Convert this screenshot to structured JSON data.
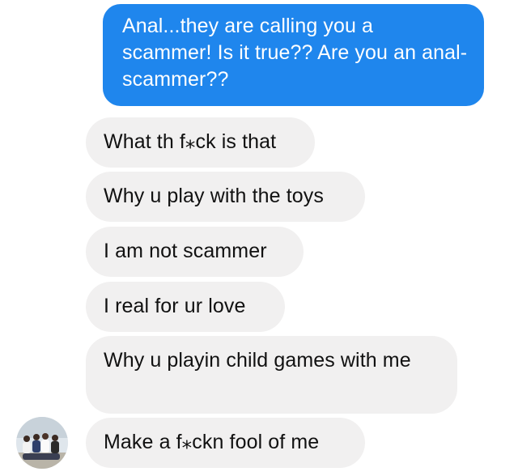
{
  "conversation": {
    "sent": [
      {
        "text": "Anal...they are calling you a scammer! Is it true?? Are you an anal-scammer??"
      }
    ],
    "received": [
      {
        "text": "What th f⁎ck is that"
      },
      {
        "text": "Why u play with the toys"
      },
      {
        "text": "I am not scammer"
      },
      {
        "text": "I real for ur love"
      },
      {
        "text": "Why u playin child games with me"
      },
      {
        "text": "Make a f⁎ckn fool of me"
      }
    ]
  },
  "contact": {
    "avatar_icon": "group-photo-avatar"
  },
  "colors": {
    "sent_bubble": "#1f86ed",
    "received_bubble": "#f1f0f0",
    "background": "#ffffff"
  }
}
